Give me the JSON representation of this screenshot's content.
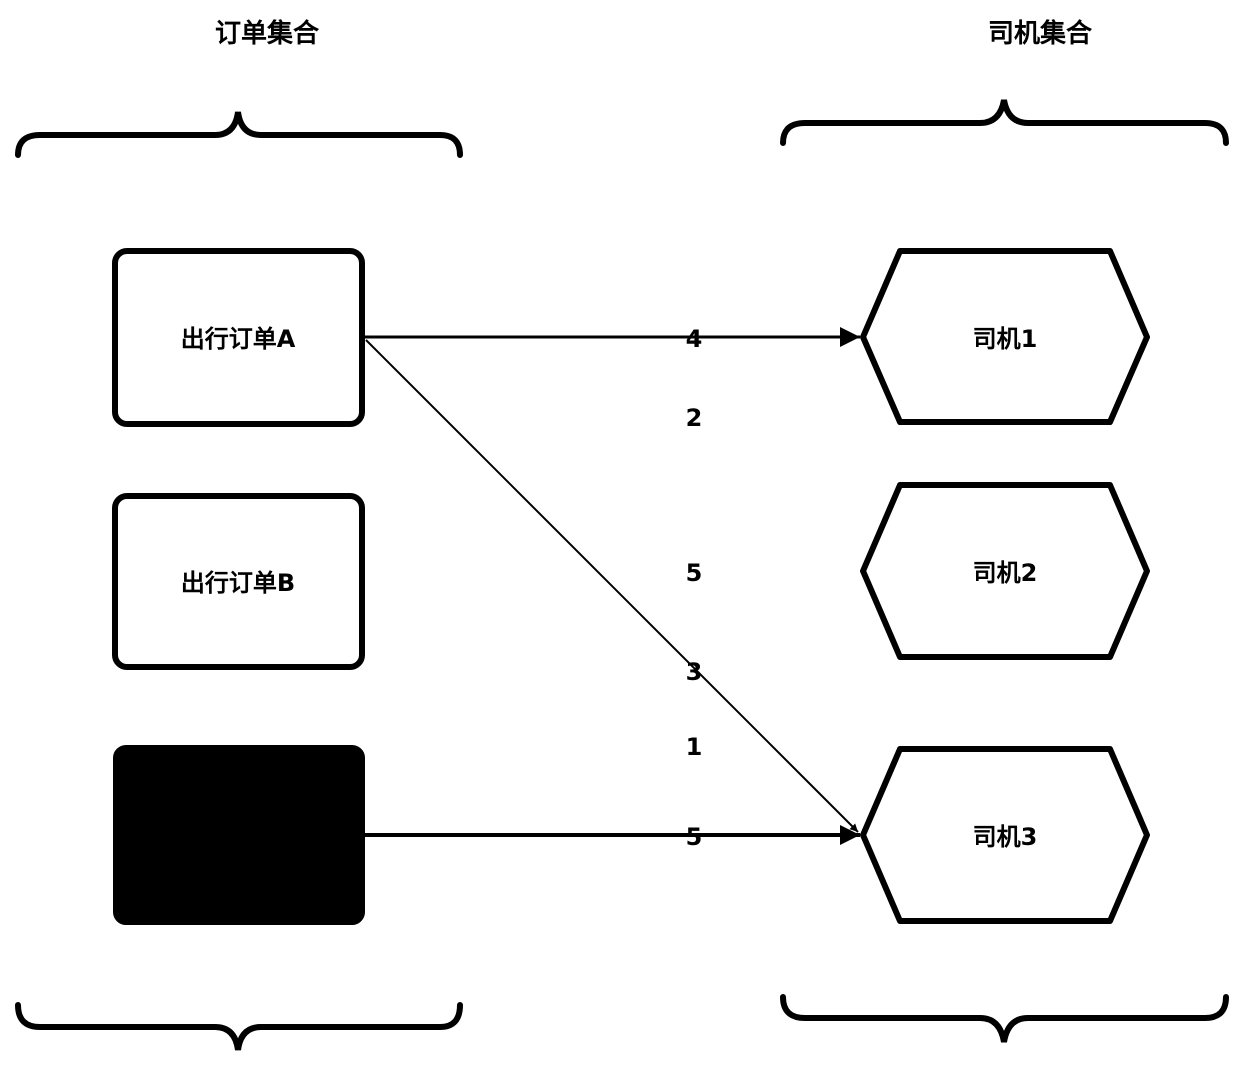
{
  "titles": {
    "orders": "订单集合",
    "drivers": "司机集合"
  },
  "orders": [
    {
      "id": "A",
      "label": "出行订单A",
      "filled": false
    },
    {
      "id": "B",
      "label": "出行订单B",
      "filled": false
    },
    {
      "id": "C",
      "label": "",
      "filled": true
    }
  ],
  "drivers": [
    {
      "id": "1",
      "label": "司机1"
    },
    {
      "id": "2",
      "label": "司机2"
    },
    {
      "id": "3",
      "label": "司机3"
    }
  ],
  "edges": [
    {
      "from": "A",
      "to": "1"
    },
    {
      "from": "A",
      "to": "3"
    },
    {
      "from": "C",
      "to": "3"
    }
  ],
  "weights": [
    "4",
    "2",
    "5",
    "3",
    "1",
    "5"
  ],
  "colors": {
    "stroke": "#000000",
    "fill": "#ffffff",
    "filled": "#000000"
  }
}
